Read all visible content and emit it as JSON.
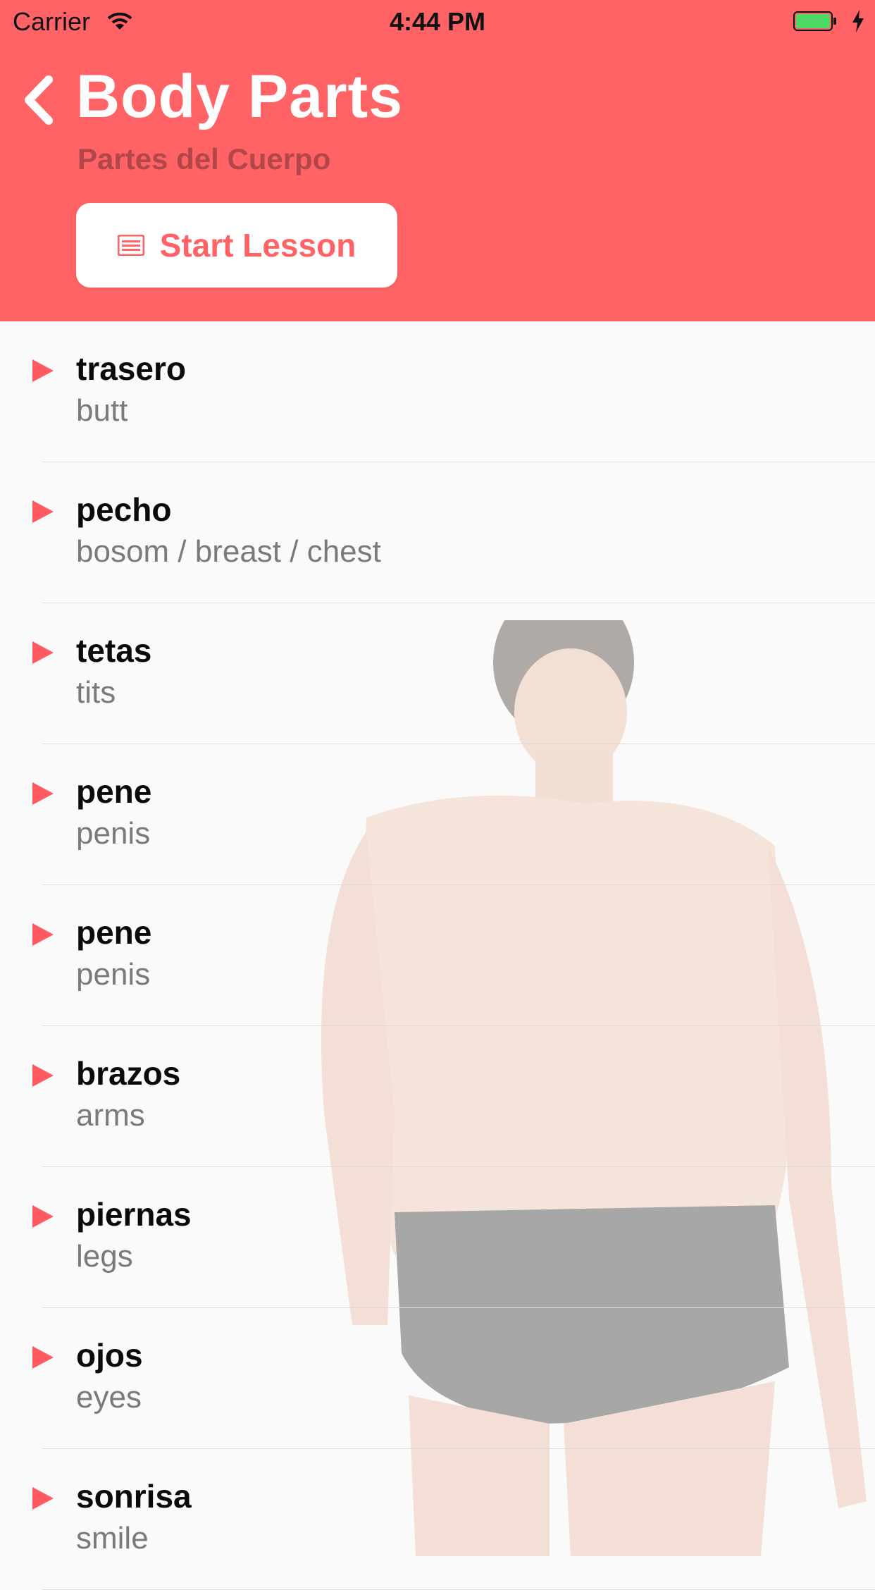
{
  "status_bar": {
    "carrier": "Carrier",
    "time": "4:44 PM"
  },
  "header": {
    "title": "Body Parts",
    "subtitle": "Partes del Cuerpo",
    "start_button_label": "Start Lesson"
  },
  "colors": {
    "accent": "#ff6366",
    "subtitle": "#b24649",
    "play_icon": "#ff5a5f",
    "battery": "#4cd964"
  },
  "vocab": [
    {
      "es": "trasero",
      "en": "butt"
    },
    {
      "es": "pecho",
      "en": "bosom / breast / chest"
    },
    {
      "es": "tetas",
      "en": "tits"
    },
    {
      "es": "pene",
      "en": "penis"
    },
    {
      "es": "pene",
      "en": "penis"
    },
    {
      "es": "brazos",
      "en": "arms"
    },
    {
      "es": "piernas",
      "en": "legs"
    },
    {
      "es": "ojos",
      "en": "eyes"
    },
    {
      "es": "sonrisa",
      "en": "smile"
    }
  ]
}
